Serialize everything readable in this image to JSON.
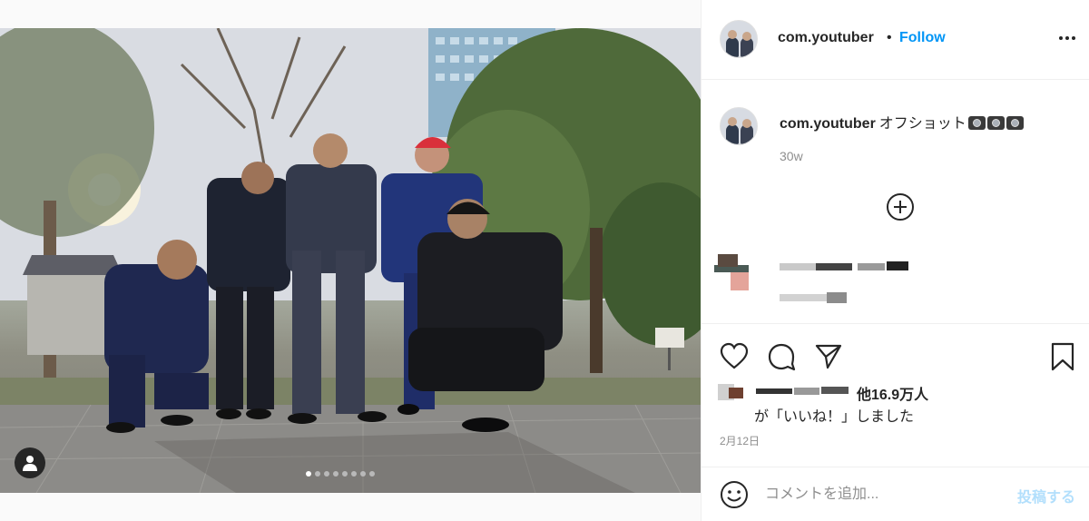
{
  "post": {
    "username": "com.youtuber",
    "separator": "•",
    "follow_label": "Follow",
    "more_icon": "more-horizontal-icon",
    "caption_text": "オフショット",
    "caption_emoji": "camera-icon",
    "caption_time": "30w",
    "photo_dots": 8,
    "photo_active_dot": 1
  },
  "actions": {
    "like_icon": "heart-icon",
    "comment_icon": "comment-icon",
    "share_icon": "paper-plane-icon",
    "save_icon": "bookmark-icon",
    "likes_count": "他16.9万人",
    "likes_suffix": "が「いいね！」しました",
    "date": "2月12日"
  },
  "comment": {
    "placeholder": "コメントを追加...",
    "post_label": "投稿する"
  },
  "colors": {
    "accent": "#0095f6",
    "post_disabled": "#b2dffc",
    "muted": "#8e8e8e"
  }
}
